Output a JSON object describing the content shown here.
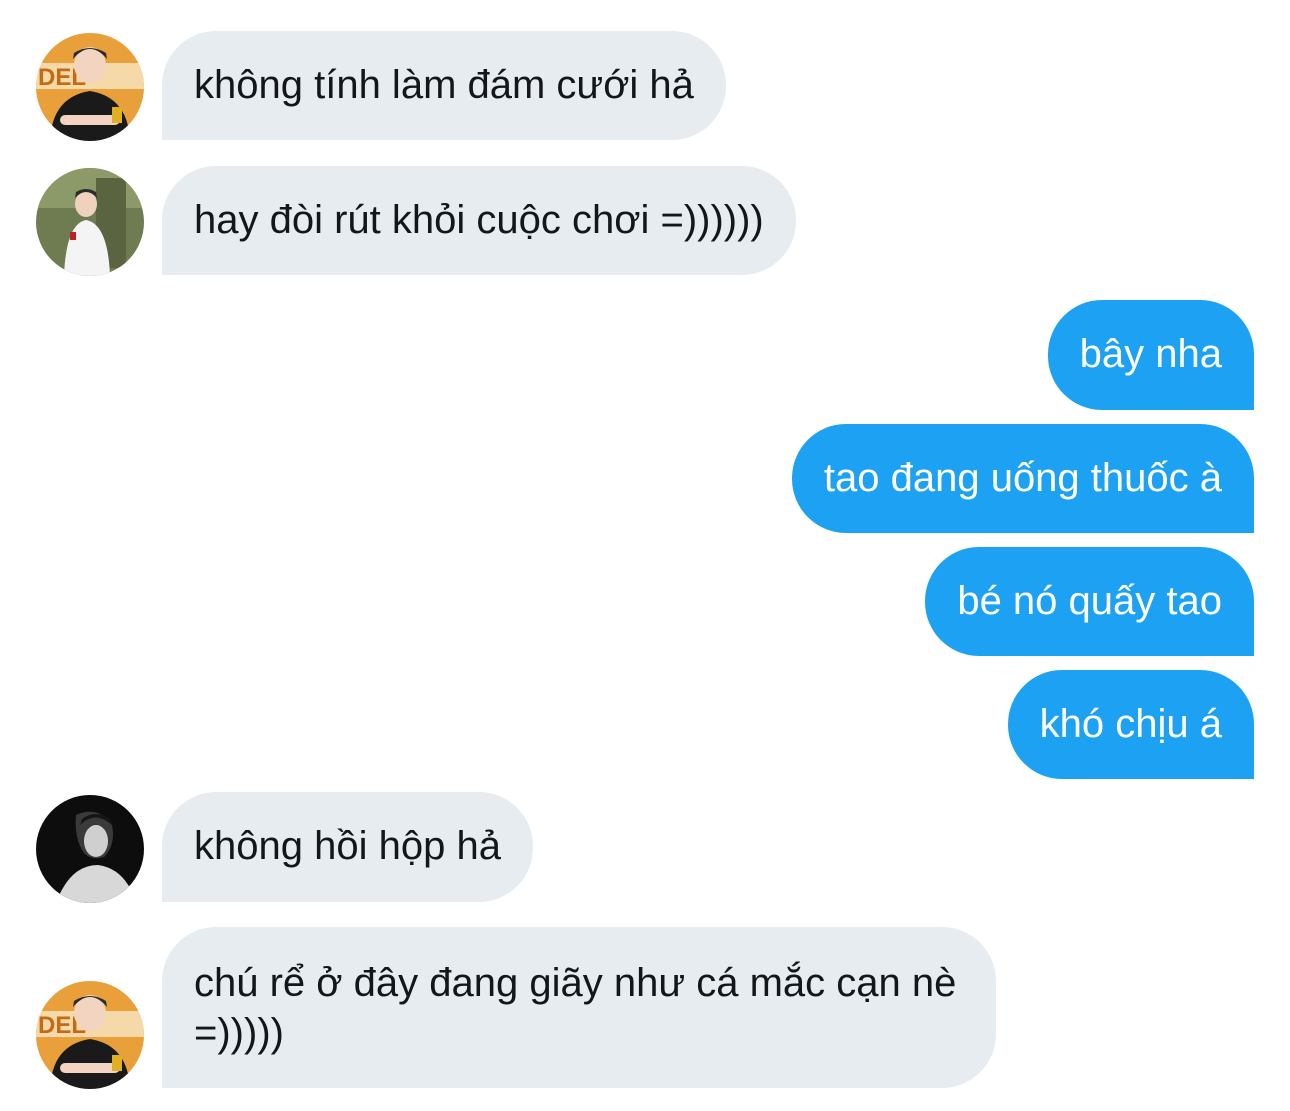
{
  "colors": {
    "incoming_bubble": "#e6ecf0",
    "outgoing_bubble": "#1da1f2",
    "incoming_text": "#14171a",
    "outgoing_text": "#ffffff"
  },
  "messages": [
    {
      "direction": "incoming",
      "avatar": "avatar-player-black-jersey",
      "text": "không tính làm đám cưới hả"
    },
    {
      "direction": "incoming",
      "avatar": "avatar-player-white-jacket",
      "text": "hay đòi rút khỏi cuộc chơi =))))))"
    },
    {
      "direction": "outgoing",
      "text": "bây nha"
    },
    {
      "direction": "outgoing",
      "text": "tao đang uống thuốc à"
    },
    {
      "direction": "outgoing",
      "text": "bé nó quấy tao"
    },
    {
      "direction": "outgoing",
      "text": "khó chịu á"
    },
    {
      "direction": "incoming",
      "avatar": "avatar-dark-portrait",
      "text": "không hồi hộp hả"
    },
    {
      "direction": "incoming",
      "avatar": "avatar-player-black-jersey",
      "text": "chú rể ở đây đang giãy như cá mắc cạn nè =)))))"
    }
  ]
}
